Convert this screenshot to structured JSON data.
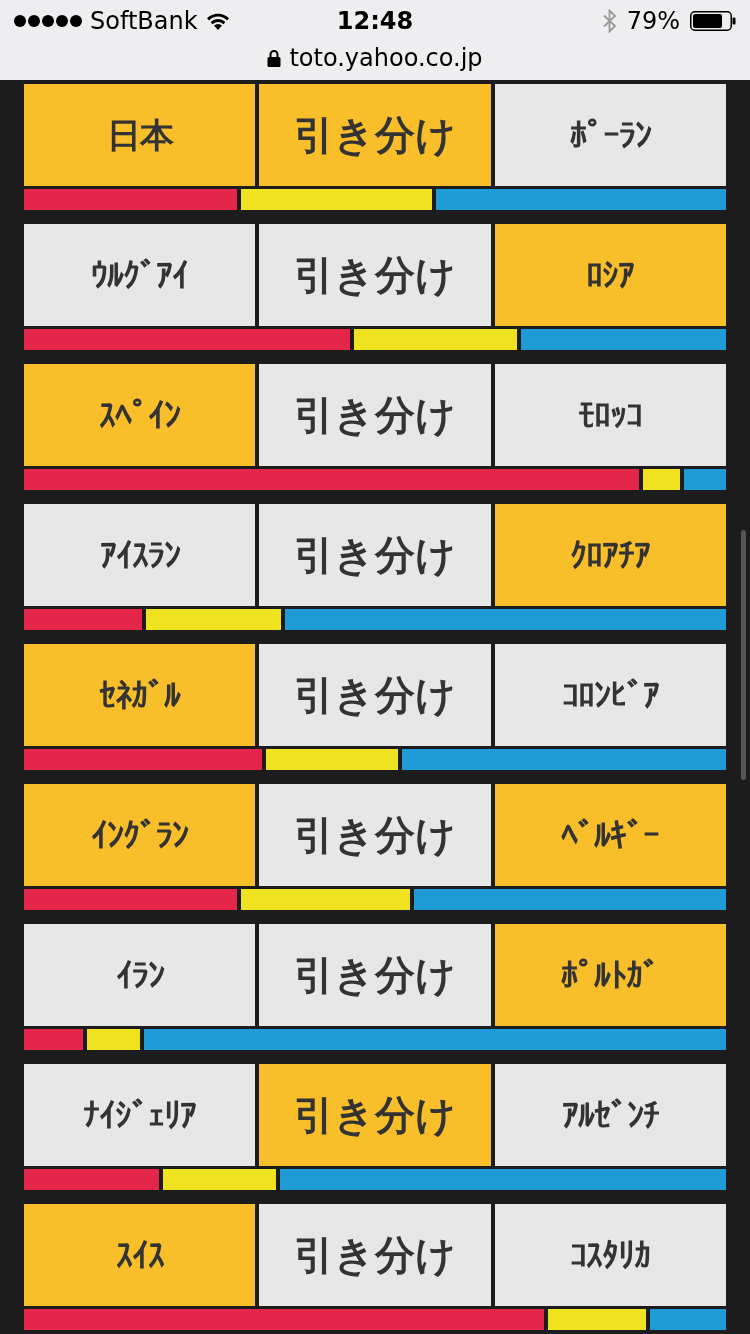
{
  "status_bar": {
    "carrier": "SoftBank",
    "time": "12:48",
    "battery": "79%"
  },
  "url_bar": {
    "url": "toto.yahoo.co.jp"
  },
  "matches": [
    {
      "options": [
        {
          "kind": "team",
          "label": "日本",
          "selected": true
        },
        {
          "kind": "draw",
          "label": "引き分け",
          "selected": true
        },
        {
          "kind": "team",
          "label": "ﾎﾟｰﾗﾝ",
          "selected": false
        }
      ],
      "shares": [
        {
          "level": 0.307,
          "color": "#e3264a"
        },
        {
          "color": "#efe221"
        },
        {
          "level": 0.418,
          "color": "#1f9bd8"
        }
      ]
    },
    {
      "options": [
        {
          "kind": "team",
          "label": "ｳﾙｸﾞｱｲ",
          "selected": false
        },
        {
          "kind": "draw",
          "label": "引き分け",
          "selected": false
        },
        {
          "kind": "team",
          "label": "ﾛｼｱ",
          "selected": true
        }
      ],
      "shares": [
        {
          "level": 0.47,
          "color": "#e3264a"
        },
        {
          "color": "#efe221"
        },
        {
          "level": 0.295,
          "color": "#1f9bd8"
        }
      ]
    },
    {
      "options": [
        {
          "kind": "team",
          "label": "ｽﾍﾟｲﾝ",
          "selected": true
        },
        {
          "kind": "draw",
          "label": "引き分け",
          "selected": false
        },
        {
          "kind": "team",
          "label": "ﾓﾛｯｺ",
          "selected": false
        }
      ],
      "shares": [
        {
          "level": 0.886,
          "color": "#e3264a"
        },
        {
          "color": "#efe221"
        },
        {
          "level": 0.061,
          "color": "#1f9bd8"
        }
      ]
    },
    {
      "options": [
        {
          "kind": "team",
          "label": "ｱｲｽﾗﾝ",
          "selected": false
        },
        {
          "kind": "draw",
          "label": "引き分け",
          "selected": false
        },
        {
          "kind": "team",
          "label": "ｸﾛｱﾁｱ",
          "selected": true
        }
      ],
      "shares": [
        {
          "level": 0.17,
          "color": "#e3264a"
        },
        {
          "color": "#efe221"
        },
        {
          "level": 0.635,
          "color": "#1f9bd8"
        }
      ]
    },
    {
      "options": [
        {
          "kind": "team",
          "label": "ｾﾈｶﾞﾙ",
          "selected": true
        },
        {
          "kind": "draw",
          "label": "引き分け",
          "selected": false
        },
        {
          "kind": "team",
          "label": "ｺﾛﾝﾋﾞｱ",
          "selected": false
        }
      ],
      "shares": [
        {
          "level": 0.343,
          "color": "#e3264a"
        },
        {
          "color": "#efe221"
        },
        {
          "level": 0.467,
          "color": "#1f9bd8"
        }
      ]
    },
    {
      "options": [
        {
          "kind": "team",
          "label": "ｲﾝｸﾞﾗﾝ",
          "selected": true
        },
        {
          "kind": "draw",
          "label": "引き分け",
          "selected": false
        },
        {
          "kind": "team",
          "label": "ﾍﾞﾙｷﾞｰ",
          "selected": true
        }
      ],
      "shares": [
        {
          "level": 0.307,
          "color": "#e3264a"
        },
        {
          "color": "#efe221"
        },
        {
          "level": 0.449,
          "color": "#1f9bd8"
        }
      ]
    },
    {
      "options": [
        {
          "kind": "team",
          "label": "ｲﾗﾝ",
          "selected": false
        },
        {
          "kind": "draw",
          "label": "引き分け",
          "selected": false
        },
        {
          "kind": "team",
          "label": "ﾎﾟﾙﾄｶﾞ",
          "selected": true
        }
      ],
      "shares": [
        {
          "level": 0.085,
          "color": "#e3264a"
        },
        {
          "color": "#efe221"
        },
        {
          "level": 0.839,
          "color": "#1f9bd8"
        }
      ]
    },
    {
      "options": [
        {
          "kind": "team",
          "label": "ﾅｲｼﾞｪﾘｱ",
          "selected": false
        },
        {
          "kind": "draw",
          "label": "引き分け",
          "selected": true
        },
        {
          "kind": "team",
          "label": "ｱﾙｾﾞﾝﾁ",
          "selected": false
        }
      ],
      "shares": [
        {
          "level": 0.195,
          "color": "#e3264a"
        },
        {
          "color": "#efe221"
        },
        {
          "level": 0.643,
          "color": "#1f9bd8"
        }
      ]
    },
    {
      "options": [
        {
          "kind": "team",
          "label": "ｽｲｽ",
          "selected": true
        },
        {
          "kind": "draw",
          "label": "引き分け",
          "selected": false
        },
        {
          "kind": "team",
          "label": "ｺｽﾀﾘｶ",
          "selected": false
        }
      ],
      "shares": [
        {
          "level": 0.749,
          "color": "#e3264a"
        },
        {
          "color": "#efe221"
        },
        {
          "level": 0.11,
          "color": "#1f9bd8"
        }
      ]
    }
  ]
}
